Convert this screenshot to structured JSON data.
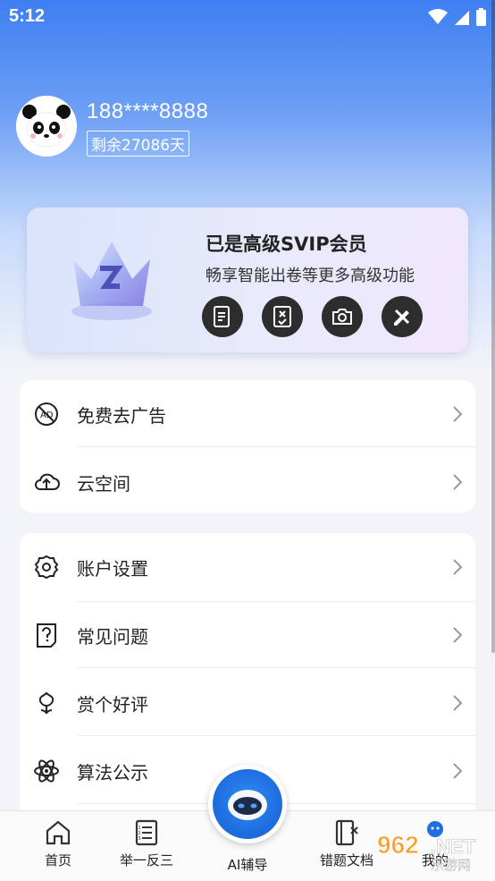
{
  "status_bar": {
    "time": "5:12"
  },
  "profile": {
    "phone": "188****8888",
    "remaining": "剩余27086天"
  },
  "vip": {
    "title": "已是高级SVIP会员",
    "subtitle": "畅享智能出卷等更多高级功能"
  },
  "menu_group_1": [
    {
      "label": "免费去广告",
      "icon": "no-ads-icon"
    },
    {
      "label": "云空间",
      "icon": "cloud-upload-icon"
    }
  ],
  "menu_group_2": [
    {
      "label": "账户设置",
      "icon": "gear-icon"
    },
    {
      "label": "常见问题",
      "icon": "question-doc-icon"
    },
    {
      "label": "赏个好评",
      "icon": "flower-icon"
    },
    {
      "label": "算法公示",
      "icon": "atom-icon"
    }
  ],
  "bottom_nav": {
    "home": "首页",
    "similar": "举一反三",
    "ai": "AI辅导",
    "mistakes": "错题文档",
    "mine": "我的"
  },
  "watermark": {
    "text": "962.NET",
    "sub": "乐游网"
  }
}
